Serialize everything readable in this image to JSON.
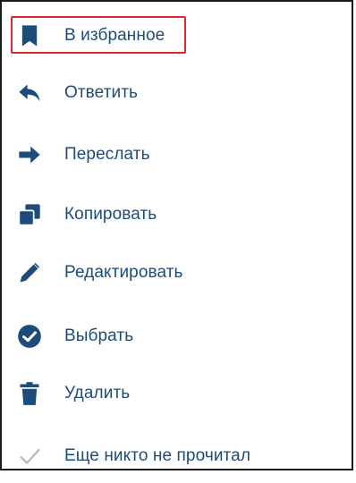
{
  "menu": {
    "items": [
      {
        "key": "favorite",
        "label": "В избранное",
        "icon": "bookmark-icon"
      },
      {
        "key": "reply",
        "label": "Ответить",
        "icon": "reply-icon"
      },
      {
        "key": "forward",
        "label": "Переслать",
        "icon": "forward-arrow-icon"
      },
      {
        "key": "copy",
        "label": "Копировать",
        "icon": "copy-icon"
      },
      {
        "key": "edit",
        "label": "Редактировать",
        "icon": "pencil-icon"
      },
      {
        "key": "select",
        "label": "Выбрать",
        "icon": "check-circle-icon"
      },
      {
        "key": "delete",
        "label": "Удалить",
        "icon": "trash-icon"
      }
    ],
    "read_status": {
      "label": "Еще никто не прочитал",
      "icon": "check-icon"
    }
  },
  "colors": {
    "icon": "#1d4c7a",
    "label": "#1d4c7a",
    "highlight": "#e0262d",
    "muted_icon": "#bbbbbb"
  }
}
